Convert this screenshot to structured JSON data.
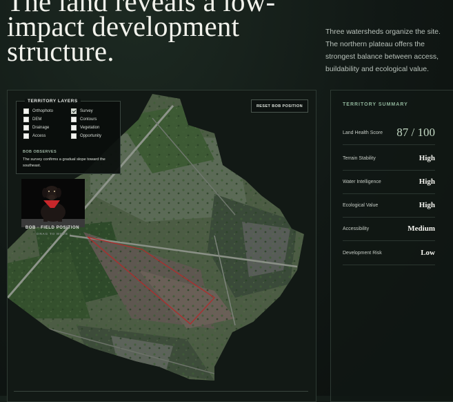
{
  "headline": "The land reveals a low-impact development structure.",
  "lede": "Three watersheds organize the site. The northern plateau offers the strongest balance between access, buildability and ecological value.",
  "map": {
    "layers_title": "TERRITORY LAYERS",
    "layers": [
      {
        "label": "Orthophoto",
        "checked": false
      },
      {
        "label": "Survey",
        "checked": true
      },
      {
        "label": "DEM",
        "checked": false
      },
      {
        "label": "Contours",
        "checked": false
      },
      {
        "label": "Drainage",
        "checked": false
      },
      {
        "label": "Vegetation",
        "checked": false
      },
      {
        "label": "Access",
        "checked": false
      },
      {
        "label": "Opportunity",
        "checked": false
      }
    ],
    "observes_title": "BOB OBSERVES",
    "observes_text": "The survey confirms a gradual slope toward the southeast.",
    "reset_label": "RESET BOB POSITION",
    "dog_label": "BOB · FIELD POSITION",
    "dog_hint": "DRAG TO MOVE"
  },
  "summary": {
    "title": "TERRITORY SUMMARY",
    "score_label": "Land Health Score",
    "score_value": "87 / 100",
    "rows": [
      {
        "label": "Terrain Stability",
        "value": "High"
      },
      {
        "label": "Water Intelligence",
        "value": "High"
      },
      {
        "label": "Ecological Value",
        "value": "High"
      },
      {
        "label": "Accessibility",
        "value": "Medium"
      },
      {
        "label": "Development Risk",
        "value": "Low"
      }
    ]
  },
  "colors": {
    "accent": "#8fb49a",
    "survey_outline": "#b42a2a",
    "background": "#111815"
  }
}
